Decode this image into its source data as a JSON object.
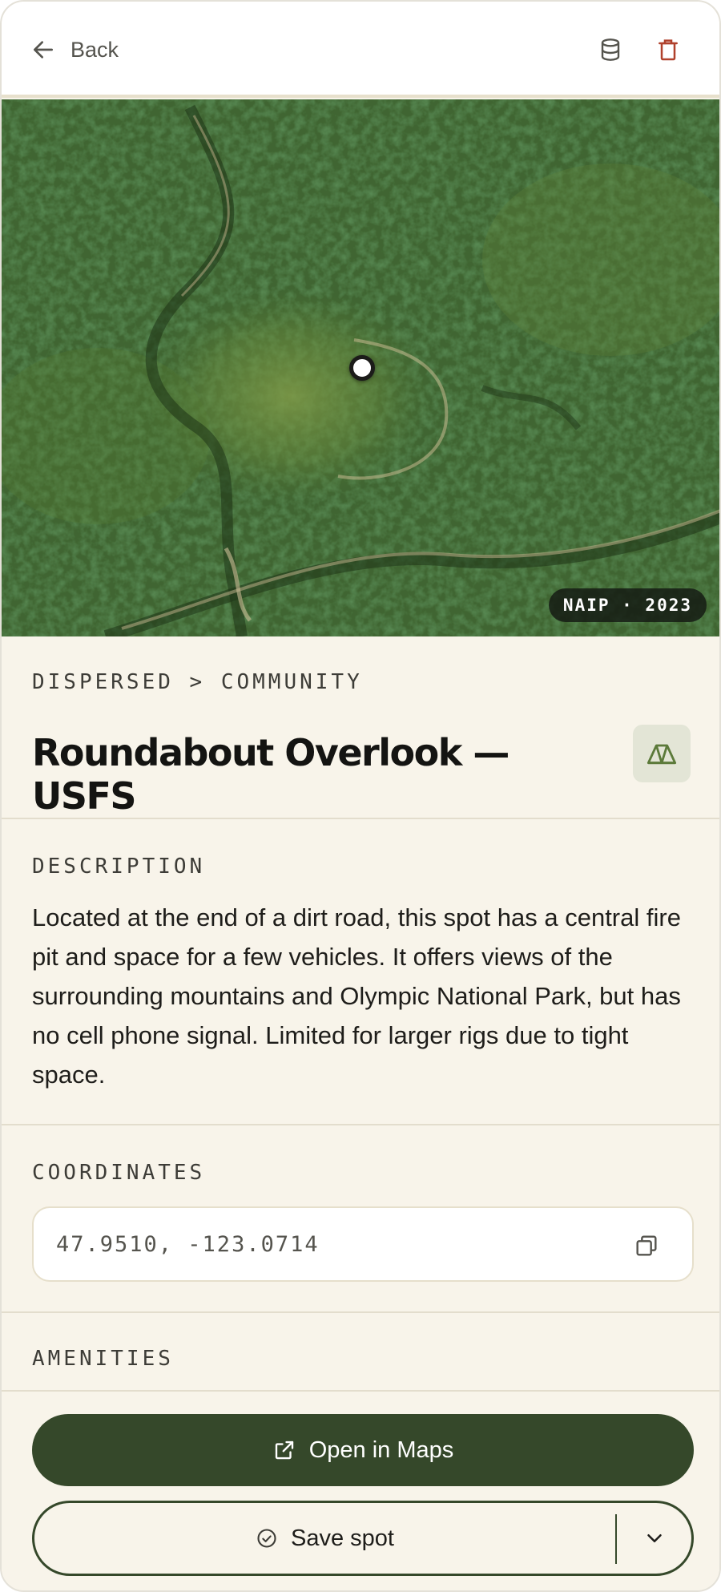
{
  "header": {
    "back_label": "Back",
    "icons": [
      "arrow-left-icon",
      "database-icon",
      "trash-icon"
    ]
  },
  "hero": {
    "imagery_badge": "NAIP · 2023"
  },
  "spot": {
    "breadcrumb": "DISPERSED > COMMUNITY",
    "title": "Roundabout Overlook — USFS",
    "type_icon": "tent-icon"
  },
  "description": {
    "label": "DESCRIPTION",
    "text": "Located at the end of a dirt road, this spot has a central fire pit and space for a few vehicles. It offers views of the surrounding mountains and Olympic National Park, but has no cell phone signal. Limited for larger rigs due to tight space."
  },
  "coordinates": {
    "label": "COORDINATES",
    "value": "47.9510, -123.0714"
  },
  "amenities": {
    "label": "AMENITIES"
  },
  "actions": {
    "open_maps_label": "Open in Maps",
    "save_label": "Save spot"
  },
  "colors": {
    "accent": "#35482a",
    "background": "#f8f4ea",
    "danger": "#b0412c",
    "chip_bg": "#e3e5d6"
  }
}
